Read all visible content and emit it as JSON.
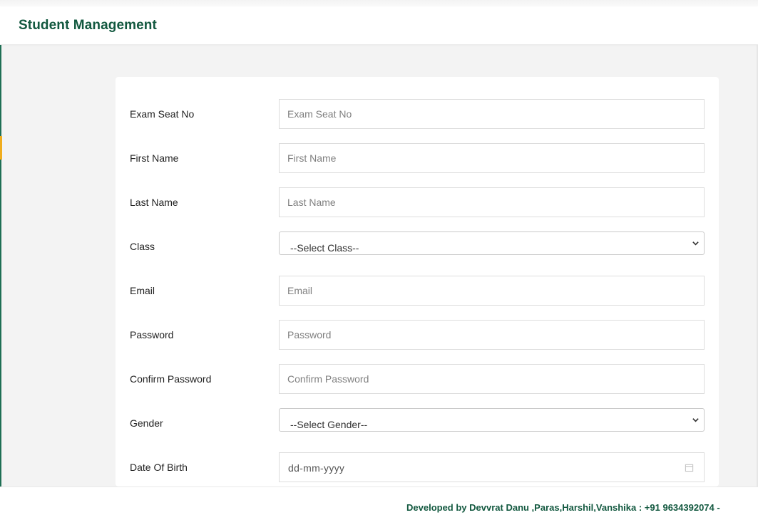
{
  "header": {
    "title": "Student Management"
  },
  "form": {
    "fields": [
      {
        "label": "Exam Seat No",
        "placeholder": "Exam Seat No"
      },
      {
        "label": "First Name",
        "placeholder": "First Name"
      },
      {
        "label": "Last Name",
        "placeholder": "Last Name"
      },
      {
        "label": "Class",
        "selected": "--Select Class--"
      },
      {
        "label": "Email",
        "placeholder": "Email"
      },
      {
        "label": "Password",
        "placeholder": "Password"
      },
      {
        "label": "Confirm Password",
        "placeholder": "Confirm Password"
      },
      {
        "label": "Gender",
        "selected": "--Select Gender--"
      },
      {
        "label": "Date Of Birth",
        "value": "dd-mm-yyyy"
      }
    ]
  },
  "footer": {
    "credits": "Developed by Devvrat Danu ,Paras,Harshil,Vanshika : +91 9634392074 -"
  },
  "colors": {
    "brand": "#12583f",
    "accent": "#f0ad1e",
    "background": "#f3f3f3"
  },
  "icons": {
    "select": "chevron-down-icon",
    "date": "calendar-icon"
  }
}
